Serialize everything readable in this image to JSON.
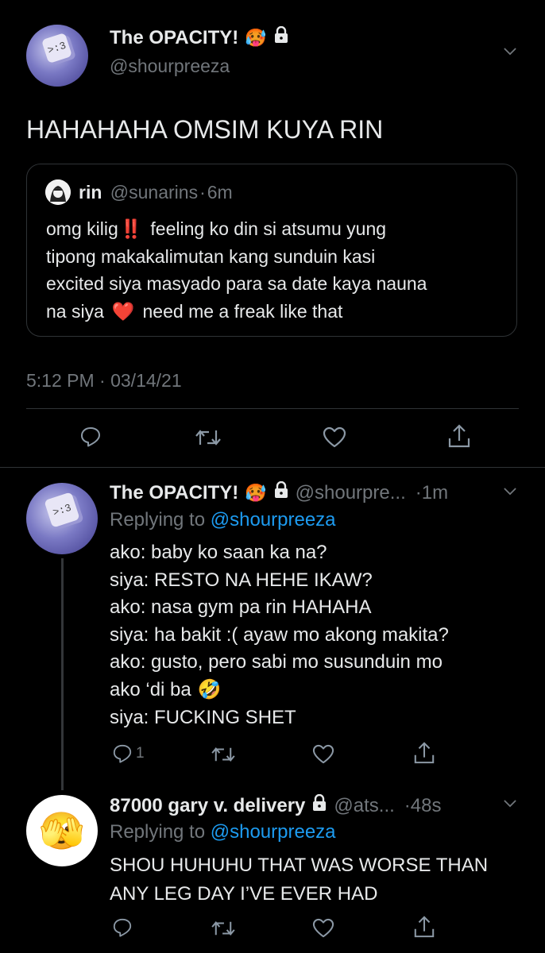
{
  "main_tweet": {
    "display_name": "The OPACITY!",
    "handle": "@shourpreeza",
    "text": "HAHAHAHA OMSIM KUYA RIN",
    "quote": {
      "name": "rin",
      "handle": "@sunarins",
      "dot": "·",
      "time": "6m",
      "lines": [
        "omg kilig",
        "feeling ko din si atsumu yung",
        "tipong makakalimutan kang sunduin kasi",
        "excited siya masyado para sa date kaya nauna",
        "na siya",
        "need me a freak like that"
      ],
      "emoji_bang": "‼️",
      "emoji_heart": "❤️"
    },
    "timestamp": "5:12 PM · 03/14/21"
  },
  "reply1": {
    "display_name": "The OPACITY!",
    "handle": "@shourpre...",
    "time": "·1m",
    "replying_prefix": "Replying to",
    "replying_to": "@shourpreeza",
    "lines": [
      "ako: baby ko saan ka na?",
      "siya: RESTO NA HEHE IKAW?",
      "ako: nasa gym pa rin HAHAHA",
      "siya: ha bakit :( ayaw mo akong makita?",
      "ako: gusto, pero sabi mo susunduin mo",
      "ako ‘di ba",
      "siya: FUCKING SHET"
    ],
    "emoji_laugh": "🤣",
    "reply_count": "1"
  },
  "reply2": {
    "display_name": "87000 gary v. delivery",
    "handle": "@ats...",
    "time": "·48s",
    "replying_prefix": "Replying to",
    "replying_to": "@shourpreeza",
    "lines": [
      "SHOU HUHUHU THAT WAS WORSE THAN",
      "ANY LEG DAY I’VE EVER HAD"
    ],
    "avatar_emoji": "🫣"
  },
  "icons": [
    "hot-face-emoji-icon",
    "lock-icon",
    "chevron-down-icon",
    "reply-icon",
    "retweet-icon",
    "like-icon",
    "share-icon"
  ],
  "colors": {
    "background": "#000000",
    "text": "#e7e9ea",
    "muted": "#71767b",
    "link": "#1d9bf0",
    "divider": "#2f3336"
  }
}
